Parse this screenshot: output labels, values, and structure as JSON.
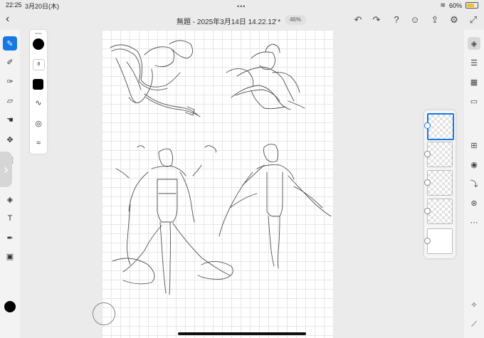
{
  "status_bar": {
    "time": "22:25",
    "date": "3月20日(木)",
    "battery": "60%"
  },
  "document": {
    "title": "無題 - 2025年3月14日 14.22.12 *",
    "zoom": "46%"
  },
  "toolbar": {
    "back_icon": "chevron-left-icon",
    "undo_icon": "undo-icon",
    "redo_icon": "redo-icon",
    "help_icon": "help-icon",
    "invite_icon": "invite-user-icon",
    "share_icon": "share-icon",
    "settings_icon": "gear-icon",
    "fullscreen_icon": "expand-icon"
  },
  "brush_panel": {
    "size": "8",
    "swatch_color": "#000000"
  },
  "left_tools": [
    {
      "name": "pixel-brush-tool",
      "active": true
    },
    {
      "name": "live-brush-tool"
    },
    {
      "name": "vector-brush-tool"
    },
    {
      "name": "eraser-tool"
    },
    {
      "name": "smudge-tool"
    },
    {
      "name": "move-tool"
    },
    {
      "name": "selection-tool"
    },
    {
      "name": "fill-tool"
    },
    {
      "name": "text-tool"
    },
    {
      "name": "eyedropper-tool"
    },
    {
      "name": "image-tool"
    }
  ],
  "current_color": "#000000",
  "accent": "#1677e5",
  "right_tools": [
    "layers-icon",
    "adjustments-icon",
    "grid-icon",
    "comment-icon",
    "add-layer-icon",
    "visibility-icon",
    "merge-icon",
    "blend-icon",
    "more-icon"
  ],
  "layers": [
    {
      "selected": true
    },
    {},
    {},
    {},
    {
      "plain": true
    }
  ]
}
